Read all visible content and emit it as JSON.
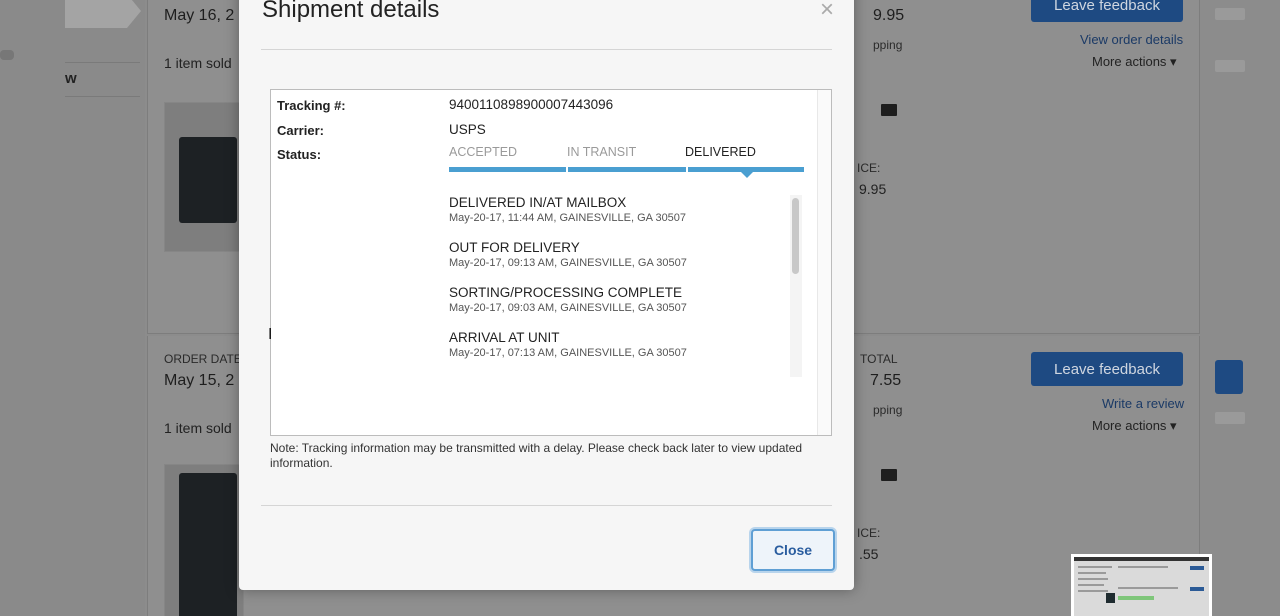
{
  "background": {
    "nav_item": "w",
    "orders": [
      {
        "date_label": "",
        "date": "May 16, 2",
        "items_sold": "1 item sold",
        "total": "9.95",
        "shipping": "pping",
        "price_label": "ICE:",
        "price": "9.95",
        "feedback_button": "Leave feedback",
        "link": "View order details",
        "more_actions": "More actions"
      },
      {
        "date_label": "ORDER DATE",
        "date": "May 15, 2",
        "items_sold": "1 item sold",
        "total_label": "TOTAL",
        "total": "7.55",
        "shipping": "pping",
        "price_label": "ICE:",
        "price": ".55",
        "feedback_button": "Leave feedback",
        "link": "Write a review",
        "more_actions": "More actions"
      }
    ]
  },
  "modal": {
    "title": "Shipment details",
    "close_symbol": "×",
    "tracking_label": "Tracking #:",
    "tracking_number": "9400110898900007443096",
    "carrier_label": "Carrier:",
    "carrier": "USPS",
    "status_label": "Status:",
    "steps": [
      {
        "label": "ACCEPTED",
        "active": false
      },
      {
        "label": "IN TRANSIT",
        "active": false
      },
      {
        "label": "DELIVERED",
        "active": true
      }
    ],
    "events": [
      {
        "title": "DELIVERED IN/AT MAILBOX",
        "meta": "May-20-17, 11:44 AM, GAINESVILLE, GA 30507"
      },
      {
        "title": "OUT FOR DELIVERY",
        "meta": "May-20-17, 09:13 AM, GAINESVILLE, GA 30507"
      },
      {
        "title": "SORTING/PROCESSING COMPLETE",
        "meta": "May-20-17, 09:03 AM, GAINESVILLE, GA 30507"
      },
      {
        "title": "ARRIVAL AT UNIT",
        "meta": "May-20-17, 07:13 AM, GAINESVILLE, GA 30507"
      }
    ],
    "note": "Note: Tracking information may be transmitted with a delay. Please check back later to view updated information.",
    "close_button": "Close"
  },
  "colors": {
    "accent": "#4a9fd1",
    "primary_button": "#1e4a82",
    "close_button_border": "#5f9fd4"
  }
}
